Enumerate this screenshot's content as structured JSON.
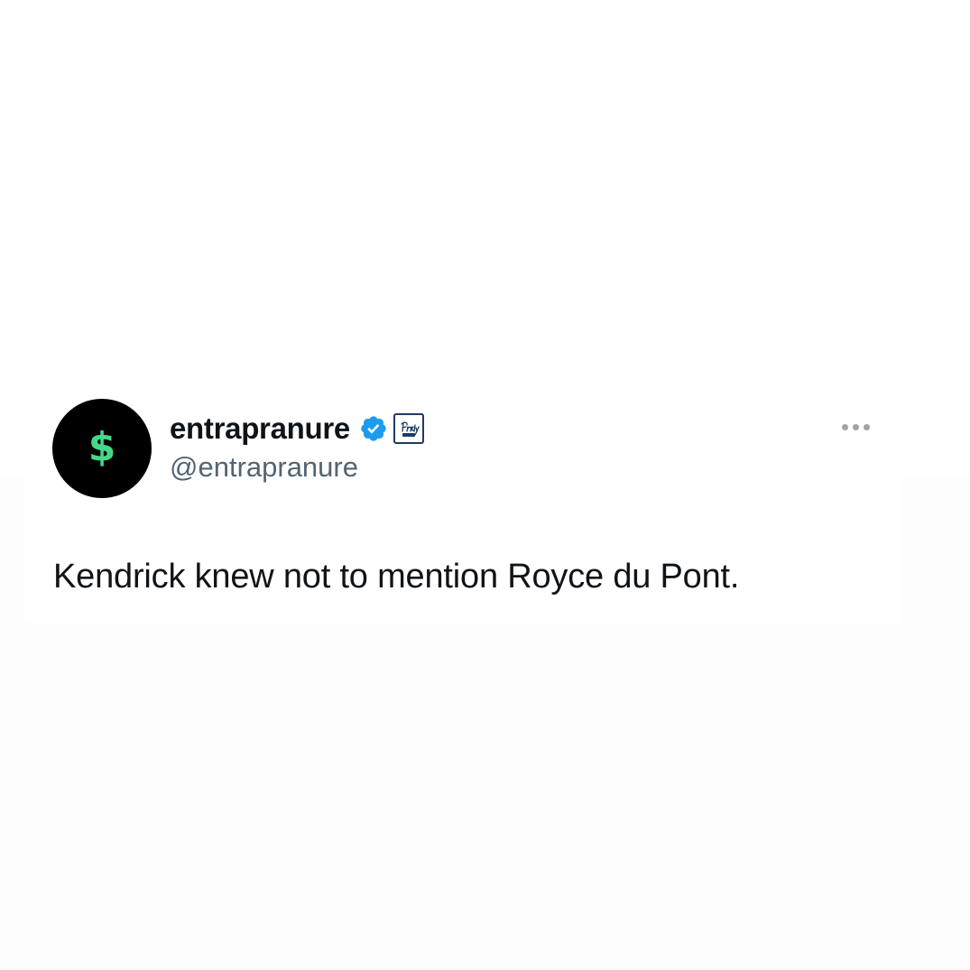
{
  "tweet": {
    "display_name": "entrapranure",
    "handle": "@entrapranure",
    "text": "Kendrick knew not to mention Royce du Pont.",
    "avatar_glyph": "$",
    "avatar_icon": "dollar-sign-icon",
    "verified_icon": "verified-badge-icon",
    "affiliate_badge": "friday-beers-badge-icon",
    "more_icon": "more-options-icon"
  },
  "colors": {
    "avatar_bg": "#000000",
    "avatar_glyph": "#46d889",
    "verified_blue": "#1d9bf0",
    "name_text": "#0f1419",
    "handle_text": "#536471",
    "badge_navy": "#1f3a64"
  }
}
